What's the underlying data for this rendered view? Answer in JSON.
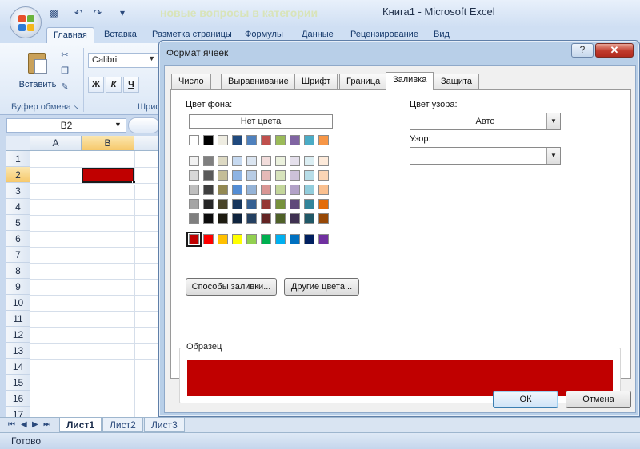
{
  "window": {
    "title": "Книга1 - Microsoft Excel",
    "faded_text": "новые вопросы в категории"
  },
  "ribbon": {
    "tabs": [
      "Главная",
      "Вставка",
      "Разметка страницы",
      "Формулы",
      "Данные",
      "Рецензирование",
      "Вид"
    ],
    "active_tab": "Главная",
    "paste_label": "Вставить",
    "clipboard_group": "Буфер обмена",
    "font_group": "Шриф",
    "font_name": "Calibri",
    "format_buttons": [
      "Ж",
      "К",
      "Ч"
    ]
  },
  "formula_bar": {
    "name_box": "B2"
  },
  "grid": {
    "columns": [
      "A",
      "B"
    ],
    "rows": [
      "1",
      "2",
      "3",
      "4",
      "5",
      "6",
      "7",
      "8",
      "9",
      "10",
      "11",
      "12",
      "13",
      "14",
      "15",
      "16",
      "17"
    ],
    "selected_cell": "B2",
    "selected_fill": "#C00000"
  },
  "sheets": {
    "tabs": [
      "Лист1",
      "Лист2",
      "Лист3"
    ],
    "active": "Лист1"
  },
  "status": "Готово",
  "dialog": {
    "title": "Формат ячеек",
    "help": "?",
    "close": "✕",
    "tabs": [
      "Число",
      "Выравнивание",
      "Шрифт",
      "Граница",
      "Заливка",
      "Защита"
    ],
    "active_tab": "Заливка",
    "bg_color_label": "Цвет фона:",
    "no_color": "Нет цвета",
    "pattern_color_label": "Цвет узора:",
    "pattern_color_value": "Авто",
    "pattern_label": "Узор:",
    "pattern_value": "",
    "fill_effects": "Способы заливки...",
    "more_colors": "Другие цвета...",
    "sample_label": "Образец",
    "sample_color": "#C00000",
    "ok": "ОК",
    "cancel": "Отмена",
    "palette_top": [
      "#FFFFFF",
      "#000000",
      "#EEECE1",
      "#1F497D",
      "#4F81BD",
      "#C0504D",
      "#9BBB59",
      "#8064A2",
      "#4BACC6",
      "#F79646"
    ],
    "palette_tints": [
      [
        "#F2F2F2",
        "#7F7F7F",
        "#DDD9C3",
        "#C6D9F0",
        "#DBE5F1",
        "#F2DCDB",
        "#EBF1DD",
        "#E5E0EC",
        "#DBEEF3",
        "#FDEADA"
      ],
      [
        "#D8D8D8",
        "#595959",
        "#C4BD97",
        "#8DB3E2",
        "#B8CCE4",
        "#E5B9B7",
        "#D7E3BC",
        "#CCC1D9",
        "#B7DDE8",
        "#FBD5B5"
      ],
      [
        "#BFBFBF",
        "#3F3F3F",
        "#938953",
        "#548DD4",
        "#95B3D7",
        "#D99694",
        "#C3D69B",
        "#B2A2C7",
        "#92CDDC",
        "#FAC08F"
      ],
      [
        "#A5A5A5",
        "#262626",
        "#494429",
        "#17365D",
        "#366092",
        "#953734",
        "#76923C",
        "#5F497A",
        "#31859B",
        "#E36C09"
      ],
      [
        "#7F7F7F",
        "#0C0C0C",
        "#1D1B10",
        "#0F243E",
        "#244061",
        "#632423",
        "#4F6128",
        "#3F3151",
        "#205867",
        "#974806"
      ]
    ],
    "palette_standard": [
      "#C00000",
      "#FF0000",
      "#FFC000",
      "#FFFF00",
      "#92D050",
      "#00B050",
      "#00B0F0",
      "#0070C0",
      "#002060",
      "#7030A0"
    ],
    "selected_standard_index": 0
  }
}
